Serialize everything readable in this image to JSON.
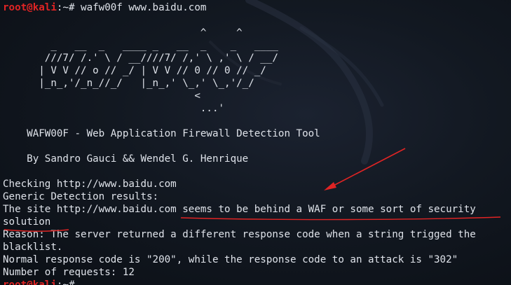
{
  "prompt": {
    "user_host": "root@kali",
    "path_symbol": ":~# ",
    "command": "wafw00f www.baidu.com"
  },
  "banner": {
    "ascii_lines": [
      "                                 ^     ^",
      "        _   __  _   ____ _   __  _    _   ____",
      "       ///7/ /.' \\ / __////7/ /,' \\ ,' \\ / __/",
      "      | V V // o // _/ | V V // 0 // 0 // _/",
      "      |_n_,'/_n_//_/   |_n_,' \\_,' \\_,'/_/",
      "                                <",
      "                                 ...'"
    ],
    "title": "    WAFW00F - Web Application Firewall Detection Tool",
    "authors": "    By Sandro Gauci && Wendel G. Henrique"
  },
  "output": {
    "checking": "Checking http://www.baidu.com",
    "generic_results": "Generic Detection results:",
    "site_line_1": "The site http://www.baidu.com seems to be behind a WAF or some sort of security",
    "site_line_2": "solution",
    "reason_line_1": "Reason: The server returned a different response code when a string trigged the",
    "reason_line_2": "blacklist.",
    "normal_response": "Normal response code is \"200\", while the response code to an attack is \"302\"",
    "requests": "Number of requests: 12"
  },
  "final_prompt": {
    "user_host": "root@kali",
    "path_symbol": ":~# "
  },
  "colors": {
    "prompt_user": "#e02424",
    "text": "#dfe3ea",
    "background": "#121821",
    "annotation": "#e02424"
  }
}
